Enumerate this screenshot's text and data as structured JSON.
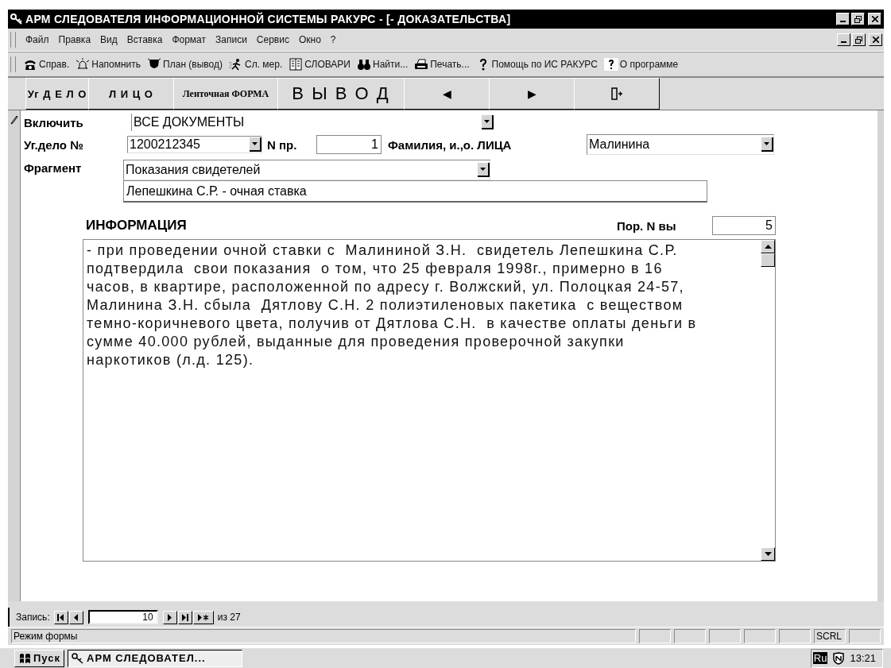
{
  "window": {
    "title": "АРМ СЛЕДОВАТЕЛЯ ИНФОРМАЦИОННОЙ СИСТЕМЫ РАКУРС - [- ДОКАЗАТЕЛЬСТВА]"
  },
  "menu": [
    "Файл",
    "Правка",
    "Вид",
    "Вставка",
    "Формат",
    "Записи",
    "Сервис",
    "Окно",
    "?"
  ],
  "toolbar": [
    {
      "label": "Справ."
    },
    {
      "label": "Напомнить"
    },
    {
      "label": "План (вывод)"
    },
    {
      "label": "Сл. мер."
    },
    {
      "label": "СЛОВАРИ"
    },
    {
      "label": "Найти..."
    },
    {
      "label": "Печать..."
    },
    {
      "label": "Помощь по ИС РАКУРС"
    },
    {
      "label": "О программе"
    }
  ],
  "form_buttons": [
    {
      "kind": "text",
      "label": "Уг Д Е Л О"
    },
    {
      "kind": "text",
      "label": "Л И Ц О"
    },
    {
      "kind": "text",
      "label": "Ленточная ФОРМА"
    },
    {
      "kind": "text",
      "label": "В Ы В О Д"
    },
    {
      "kind": "text",
      "label": "◀"
    },
    {
      "kind": "text",
      "label": "▶"
    },
    {
      "kind": "exit"
    }
  ],
  "form": {
    "include_label": "Включить",
    "include_value": "ВСЕ ДОКУМЕНТЫ",
    "case_label": "Уг.дело №",
    "case_value": "1200212345",
    "npr_label": "N пр.",
    "npr_value": "1",
    "person_label": "Фамилия, и.,о. ЛИЦА",
    "person_value": "Малинина",
    "fragment_label": "Фрагмент",
    "fragment_value": "Показания свидетелей",
    "subfragment_value": "Лепешкина С.Р. - очная ставка",
    "info_label": "ИНФОРМАЦИЯ",
    "order_label": "Пор. N вы",
    "order_value": "5",
    "info_text": "- при проведении очной ставки с  Малининой З.Н.  свидетель Лепешкина С.Р.\nподтвердила  свои показания  о том, что 25 февраля 1998г., примерно в 16\nчасов, в квартире, расположенной по адресу г. Волжский, ул. Полоцкая 24-57,\nМалинина З.Н. сбыла  Дятлову С.Н. 2 полиэтиленовых пакетика  с веществом\nтемно-коричневого цвета, получив от Дятлова С.Н.  в качестве оплаты деньги в\nсумме 40.000 рублей, выданные для проведения проверочной закупки\nнаркотиков (л.д. 125)."
  },
  "record_nav": {
    "label": "Запись:",
    "value": "10",
    "total": "из 27"
  },
  "status_bar": {
    "text": "Режим формы",
    "indicator": "SCRL"
  },
  "taskbar": {
    "start": "Пуск",
    "task": "АРМ СЛЕДОВАТЕЛ...",
    "language": "Ru",
    "clock": "13:21"
  }
}
